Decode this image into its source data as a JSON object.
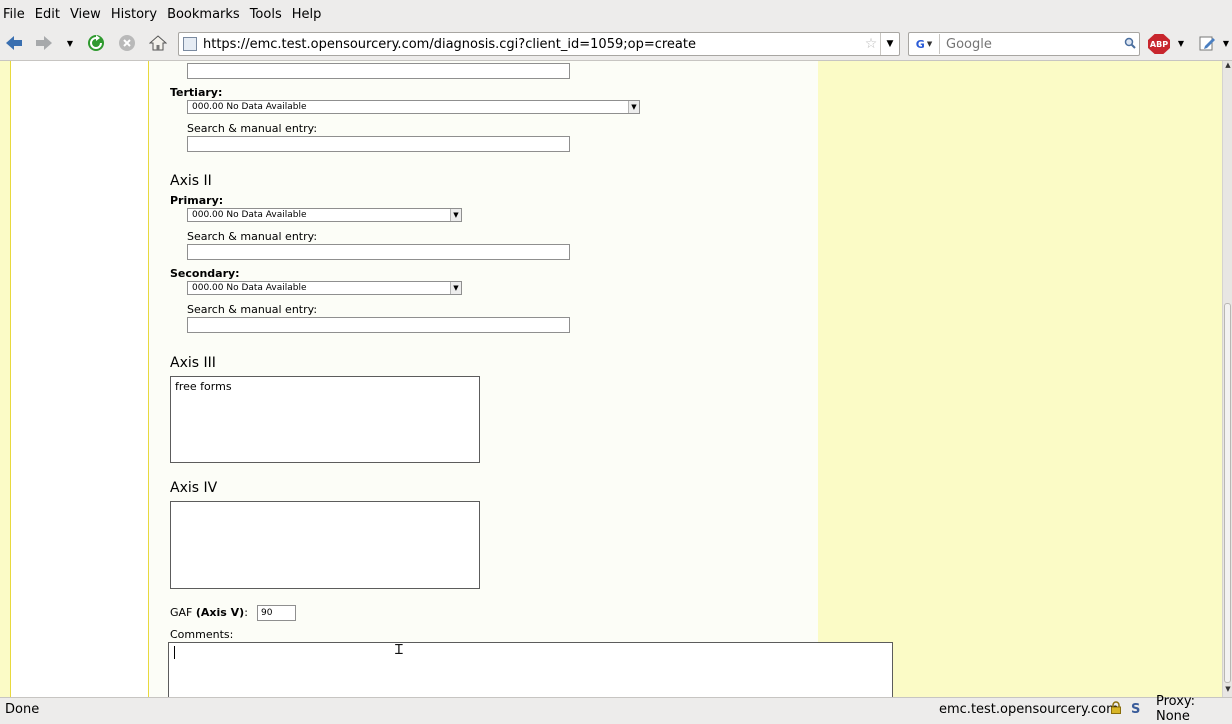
{
  "menu": [
    "File",
    "Edit",
    "View",
    "History",
    "Bookmarks",
    "Tools",
    "Help"
  ],
  "address_bar": {
    "url": "https://emc.test.opensourcery.com/diagnosis.cgi?client_id=1059;op=create"
  },
  "search_bar": {
    "engine": "G",
    "placeholder": "Google"
  },
  "extension_badge": "ABP",
  "form": {
    "tertiary": {
      "label": "Tertiary:",
      "selected": "000.00 No Data Available",
      "search_label": "Search & manual entry:"
    },
    "axis_ii": {
      "heading": "Axis II",
      "primary": {
        "label": "Primary:",
        "selected": "000.00 No Data Available",
        "search_label": "Search & manual entry:"
      },
      "secondary": {
        "label": "Secondary:",
        "selected": "000.00 No Data Available",
        "search_label": "Search & manual entry:"
      }
    },
    "axis_iii": {
      "heading": "Axis III",
      "value": "free forms"
    },
    "axis_iv": {
      "heading": "Axis IV",
      "value": ""
    },
    "gaf": {
      "label": "GAF",
      "label_bold": "(Axis V)",
      "colon": ":",
      "value": "90"
    },
    "comments": {
      "label": "Comments:",
      "value": ""
    }
  },
  "status_bar": {
    "text": "Done",
    "host": "emc.test.opensourcery.com",
    "s_icon": "S",
    "proxy": "Proxy: None"
  },
  "colors": {
    "page_background": "#fbfbc6",
    "border_yellow": "#e8d93e",
    "reload_green": "#2f9a2f",
    "back_blue": "#3a6fb0",
    "abp_red": "#c8262d"
  }
}
